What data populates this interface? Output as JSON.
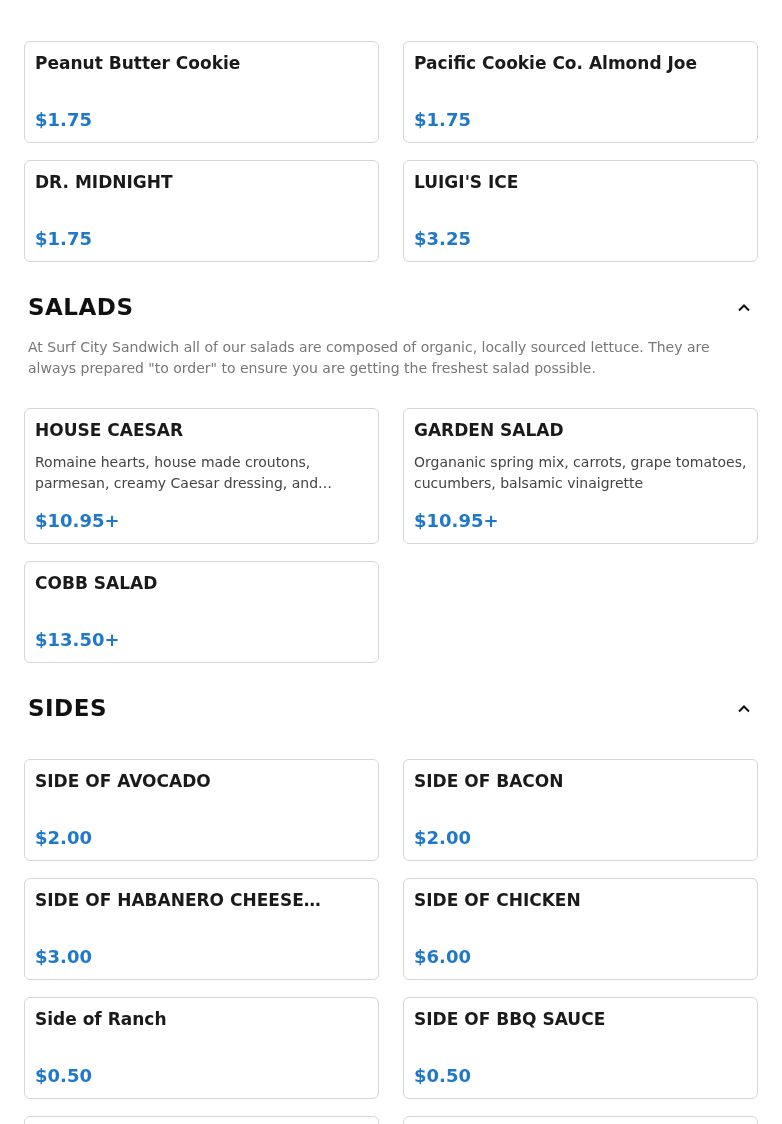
{
  "sections": [
    {
      "items": [
        {
          "name": "Peanut Butter Cookie",
          "price": "$1.75"
        },
        {
          "name": "Pacific Cookie Co. Almond Joe",
          "price": "$1.75"
        },
        {
          "name": "DR. MIDNIGHT",
          "price": "$1.75"
        },
        {
          "name": "LUIGI'S ICE",
          "price": "$3.25"
        }
      ]
    },
    {
      "title": "SALADS",
      "expanded": true,
      "description": "At Surf City Sandwich all of our salads are composed of organic, locally sourced lettuce. They are always prepared \"to order\" to ensure you are getting the freshest salad possible.",
      "items": [
        {
          "name": "HOUSE CAESAR",
          "description": "Romaine hearts, house made croutons, parmesan, creamy Caesar dressing, and…",
          "price": "$10.95+"
        },
        {
          "name": "GARDEN SALAD",
          "description": "Organanic spring mix, carrots, grape tomatoes, cucumbers, balsamic vinaigrette",
          "price": "$10.95+"
        },
        {
          "name": "COBB SALAD",
          "price": "$13.50+"
        }
      ]
    },
    {
      "title": "SIDES",
      "expanded": true,
      "items": [
        {
          "name": "SIDE OF AVOCADO",
          "price": "$2.00"
        },
        {
          "name": "SIDE OF BACON",
          "price": "$2.00"
        },
        {
          "name": "SIDE OF HABANERO CHEESE…",
          "price": "$3.00"
        },
        {
          "name": "SIDE OF CHICKEN",
          "price": "$6.00"
        },
        {
          "name": "Side of Ranch",
          "price": "$0.50"
        },
        {
          "name": "SIDE OF BBQ SAUCE",
          "price": "$0.50"
        }
      ]
    }
  ]
}
